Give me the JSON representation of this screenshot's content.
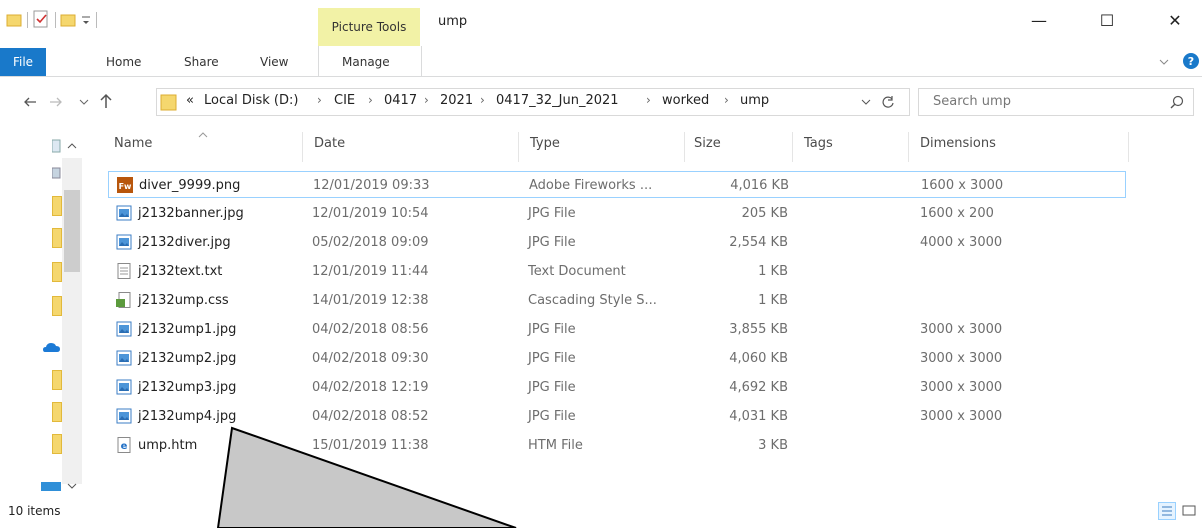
{
  "window": {
    "title": "ump",
    "context_tab": "Picture Tools",
    "minimize": "—",
    "maximize": "☐",
    "close": "✕"
  },
  "ribbon": {
    "tabs": [
      "File",
      "Home",
      "Share",
      "View",
      "Manage"
    ]
  },
  "address": {
    "prefix": "«",
    "crumbs": [
      "Local Disk (D:)",
      "CIE",
      "0417",
      "2021",
      "0417_32_Jun_2021",
      "worked",
      "ump"
    ],
    "search_placeholder": "Search ump"
  },
  "columns": [
    "Name",
    "Date",
    "Type",
    "Size",
    "Tags",
    "Dimensions"
  ],
  "files": [
    {
      "name": "diver_9999.png",
      "date": "12/01/2019 09:33",
      "type": "Adobe Fireworks ...",
      "size": "4,016 KB",
      "dims": "1600 x 3000",
      "icon": "fireworks-file-icon"
    },
    {
      "name": "j2132banner.jpg",
      "date": "12/01/2019 10:54",
      "type": "JPG File",
      "size": "205 KB",
      "dims": "1600 x 200",
      "icon": "image-file-icon"
    },
    {
      "name": "j2132diver.jpg",
      "date": "05/02/2018 09:09",
      "type": "JPG File",
      "size": "2,554 KB",
      "dims": "4000 x 3000",
      "icon": "image-file-icon"
    },
    {
      "name": "j2132text.txt",
      "date": "12/01/2019 11:44",
      "type": "Text Document",
      "size": "1 KB",
      "dims": "",
      "icon": "text-file-icon"
    },
    {
      "name": "j2132ump.css",
      "date": "14/01/2019 12:38",
      "type": "Cascading Style S...",
      "size": "1 KB",
      "dims": "",
      "icon": "css-file-icon"
    },
    {
      "name": "j2132ump1.jpg",
      "date": "04/02/2018 08:56",
      "type": "JPG File",
      "size": "3,855 KB",
      "dims": "3000 x 3000",
      "icon": "image-file-icon"
    },
    {
      "name": "j2132ump2.jpg",
      "date": "04/02/2018 09:30",
      "type": "JPG File",
      "size": "4,060 KB",
      "dims": "3000 x 3000",
      "icon": "image-file-icon"
    },
    {
      "name": "j2132ump3.jpg",
      "date": "04/02/2018 12:19",
      "type": "JPG File",
      "size": "4,692 KB",
      "dims": "3000 x 3000",
      "icon": "image-file-icon"
    },
    {
      "name": "j2132ump4.jpg",
      "date": "04/02/2018 08:52",
      "type": "JPG File",
      "size": "4,031 KB",
      "dims": "3000 x 3000",
      "icon": "image-file-icon"
    },
    {
      "name": "ump.htm",
      "date": "15/01/2019 11:38",
      "type": "HTM File",
      "size": "3 KB",
      "dims": "",
      "icon": "html-file-icon"
    }
  ],
  "status": {
    "item_count": "10 items"
  },
  "colors": {
    "accent": "#1979ca",
    "context_tab": "#f2f2a6",
    "selection_border": "#99d1ff",
    "callout_fill": "#c8c8c8"
  }
}
